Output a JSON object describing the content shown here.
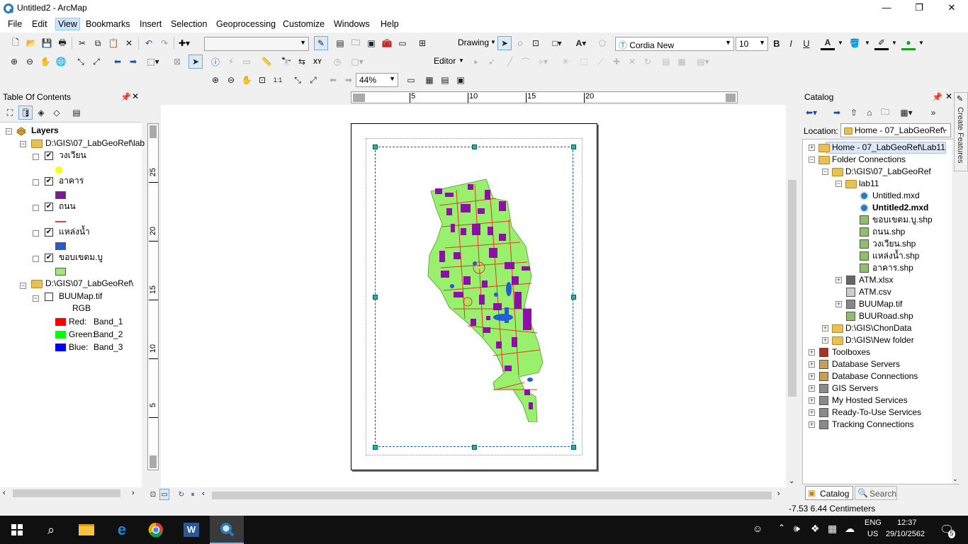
{
  "window": {
    "title": "Untitled2 - ArcMap",
    "min": "—",
    "max": "❐",
    "close": "✕"
  },
  "menu": [
    "File",
    "Edit",
    "View",
    "Bookmarks",
    "Insert",
    "Selection",
    "Geoprocessing",
    "Customize",
    "Windows",
    "Help"
  ],
  "menu_active": "View",
  "toolbar": {
    "drawing_label": "Drawing",
    "font": "Cordia New",
    "font_size": "10",
    "bold": "B",
    "italic": "I",
    "underline": "U",
    "editor_label": "Editor",
    "zoom": "44%"
  },
  "toc": {
    "title": "Table Of Contents",
    "root": "Layers",
    "group1": "D:\\GIS\\07_LabGeoRef\\lab",
    "layers": [
      {
        "name": "วงเวียน",
        "checked": true,
        "color": "#ffff00"
      },
      {
        "name": "อาคาร",
        "checked": true,
        "color": "#8c10a8"
      },
      {
        "name": "ถนน",
        "checked": true,
        "color": "#ff3030"
      },
      {
        "name": "แหล่งน้ำ",
        "checked": true,
        "color": "#1e5fd8"
      },
      {
        "name": "ขอบเขตม.บู",
        "checked": true,
        "color": "#98f06c"
      }
    ],
    "group2": "D:\\GIS\\07_LabGeoRef\\",
    "raster": "BUUMap.tif",
    "raster_checked": false,
    "rgb": "RGB",
    "bands": [
      {
        "label": "Red:",
        "band": "Band_1",
        "color": "#ff0000"
      },
      {
        "label": "Green:",
        "band": "Band_2",
        "color": "#00ff00"
      },
      {
        "label": "Blue:",
        "band": "Band_3",
        "color": "#0000ff"
      }
    ]
  },
  "ruler": {
    "top": [
      "5",
      "10",
      "15",
      "20"
    ],
    "left": [
      "25",
      "20",
      "15",
      "10",
      "5"
    ]
  },
  "catalog": {
    "title": "Catalog",
    "location_label": "Location:",
    "location_value": "Home - 07_LabGeoRef\\",
    "items": [
      {
        "label": "Home - 07_LabGeoRef\\Lab11",
        "level": 0,
        "exp": "+",
        "icon": "home-folder",
        "sel": true
      },
      {
        "label": "Folder Connections",
        "level": 0,
        "exp": "−",
        "icon": "folder"
      },
      {
        "label": "D:\\GIS\\07_LabGeoRef",
        "level": 1,
        "exp": "−",
        "icon": "folder"
      },
      {
        "label": "lab11",
        "level": 2,
        "exp": "−",
        "icon": "folder"
      },
      {
        "label": "Untitled.mxd",
        "level": 3,
        "exp": "",
        "icon": "mxd"
      },
      {
        "label": "Untitled2.mxd",
        "level": 3,
        "exp": "",
        "icon": "mxd",
        "bold": true
      },
      {
        "label": "ขอบเขตม.บู.shp",
        "level": 3,
        "exp": "",
        "icon": "shp-poly"
      },
      {
        "label": "ถนน.shp",
        "level": 3,
        "exp": "",
        "icon": "shp-line"
      },
      {
        "label": "วงเวียน.shp",
        "level": 3,
        "exp": "",
        "icon": "shp-point"
      },
      {
        "label": "แหล่งน้ำ.shp",
        "level": 3,
        "exp": "",
        "icon": "shp-poly"
      },
      {
        "label": "อาคาร.shp",
        "level": 3,
        "exp": "",
        "icon": "shp-poly"
      },
      {
        "label": "ATM.xlsx",
        "level": 2,
        "exp": "+",
        "icon": "table"
      },
      {
        "label": "ATM.csv",
        "level": 2,
        "exp": "",
        "icon": "file"
      },
      {
        "label": "BUUMap.tif",
        "level": 2,
        "exp": "+",
        "icon": "raster"
      },
      {
        "label": "BUURoad.shp",
        "level": 2,
        "exp": "",
        "icon": "shp-line"
      },
      {
        "label": "D:\\GIS\\ChonData",
        "level": 1,
        "exp": "+",
        "icon": "folder"
      },
      {
        "label": "D:\\GIS\\New folder",
        "level": 1,
        "exp": "+",
        "icon": "folder"
      },
      {
        "label": "Toolboxes",
        "level": 0,
        "exp": "+",
        "icon": "toolbox"
      },
      {
        "label": "Database Servers",
        "level": 0,
        "exp": "+",
        "icon": "db"
      },
      {
        "label": "Database Connections",
        "level": 0,
        "exp": "+",
        "icon": "db"
      },
      {
        "label": "GIS Servers",
        "level": 0,
        "exp": "+",
        "icon": "server"
      },
      {
        "label": "My Hosted Services",
        "level": 0,
        "exp": "+",
        "icon": "server"
      },
      {
        "label": "Ready-To-Use Services",
        "level": 0,
        "exp": "+",
        "icon": "server"
      },
      {
        "label": "Tracking Connections",
        "level": 0,
        "exp": "+",
        "icon": "server"
      }
    ],
    "tab_catalog": "Catalog",
    "tab_search": "Search"
  },
  "side_tab": "Create Features",
  "status": {
    "coords": "-7.53  6.44 Centimeters"
  },
  "taskbar": {
    "lang1": "ENG",
    "lang2": "US",
    "time": "12:37",
    "date": "29/10/2562",
    "notif": "5"
  }
}
